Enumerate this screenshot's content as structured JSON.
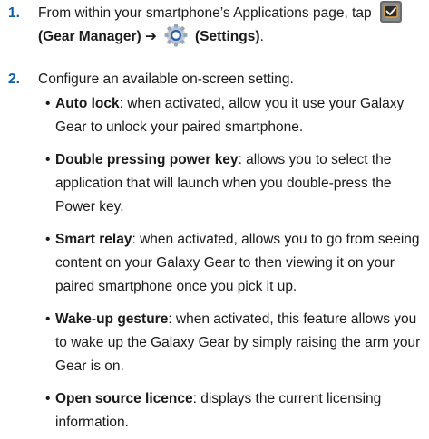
{
  "steps": [
    {
      "number": "1.",
      "text_before": "From within your smartphone’s Applications page, tap",
      "gear_manager_label": "(Gear Manager)",
      "arrow": "➔",
      "settings_label": "(Settings)",
      "text_after": "."
    },
    {
      "number": "2.",
      "text": "Configure an available on-screen setting."
    }
  ],
  "settings": [
    {
      "term": "Auto lock",
      "desc": ": when activated, allow you it use your Galaxy Gear to unlock your paired smartphone."
    },
    {
      "term": "Double pressing power key",
      "desc": ": allows you to select the application that will launch when you double-press the Power key."
    },
    {
      "term": "Smart relay",
      "desc": ": when activated, allows you to go from seeing content on your Galaxy Gear to then viewing it on your paired smartphone once you pick it up."
    },
    {
      "term": "Wake-up gesture",
      "desc": ": when activated, this feature allows you to wake up the Galaxy Gear by simply raising the arm your Gear is on."
    },
    {
      "term": "Open source licence",
      "desc": ": displays the current licensing information."
    }
  ],
  "icons": {
    "gear_manager": "gear-manager-app-icon",
    "settings": "settings-gear-icon",
    "bullet_char": "•"
  },
  "colors": {
    "step_number": "#0b5fa5"
  }
}
